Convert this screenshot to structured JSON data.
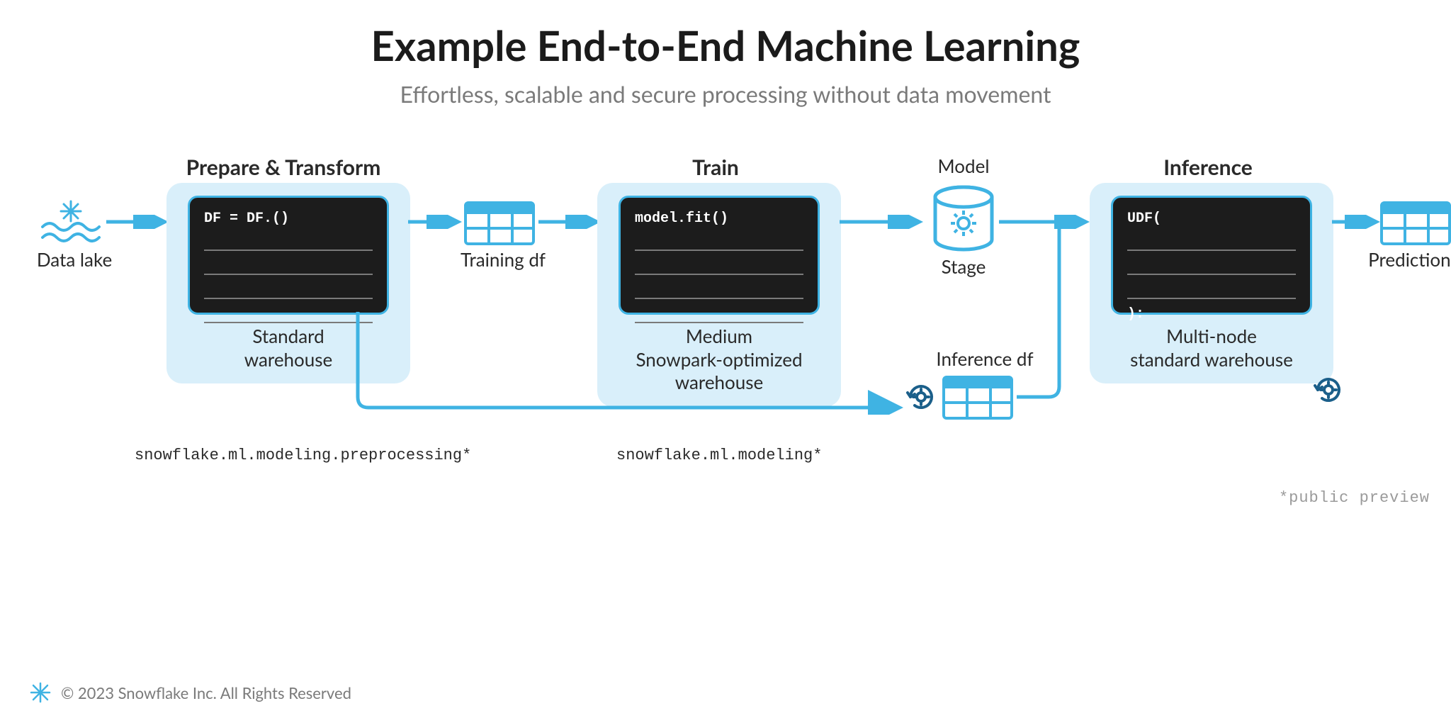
{
  "title": "Example End-to-End Machine Learning",
  "subtitle": "Effortless, scalable and secure processing without data movement",
  "colors": {
    "accent": "#3fb3e3",
    "accent_dark": "#1b5f8a",
    "card_bg": "#d9effa",
    "code_bg": "#1c1c1c"
  },
  "stages": {
    "prepare": {
      "title": "Prepare & Transform",
      "code": "DF = DF.()",
      "caption": "Standard\nwarehouse",
      "package": "snowflake.ml.modeling.preprocessing*"
    },
    "train": {
      "title": "Train",
      "code": "model.fit()",
      "caption": "Medium\nSnowpark-optimized\nwarehouse",
      "package": "snowflake.ml.modeling*"
    },
    "inference": {
      "title": "Inference",
      "code_top": "UDF(",
      "code_bottom": "):",
      "caption": "Multi-node\nstandard warehouse"
    }
  },
  "nodes": {
    "data_lake": "Data lake",
    "training_df": "Training df",
    "model": "Model",
    "stage": "Stage",
    "inference_df": "Inference df",
    "predictions": "Predictions"
  },
  "preview_note": "*public preview",
  "footer": "© 2023 Snowflake Inc. All Rights Reserved"
}
